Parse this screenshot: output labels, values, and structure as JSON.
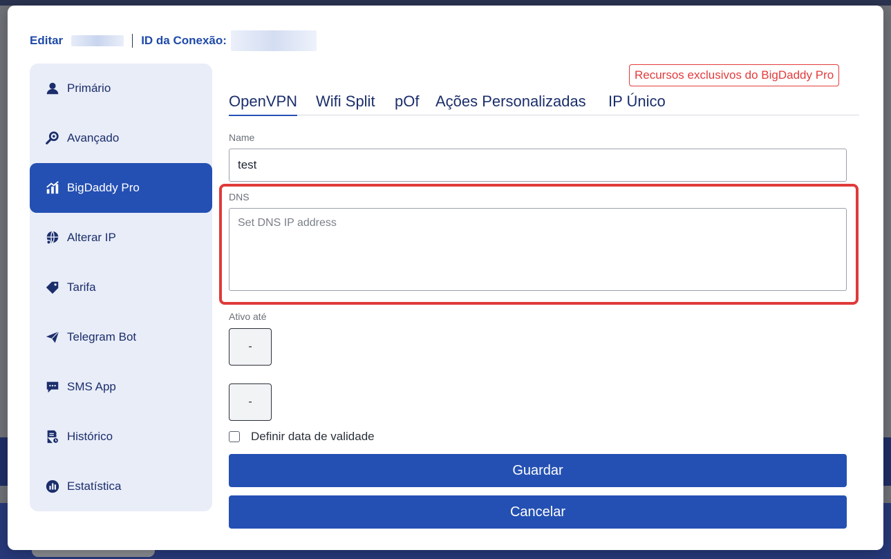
{
  "header": {
    "edit_label": "Editar",
    "connection_id_label": "ID da Conexão:"
  },
  "sidebar": {
    "items": [
      {
        "label": "Primário",
        "icon": "user-icon",
        "active": false
      },
      {
        "label": "Avançado",
        "icon": "gear-search-icon",
        "active": false
      },
      {
        "label": "BigDaddy Pro",
        "icon": "chart-icon",
        "active": true
      },
      {
        "label": "Alterar IP",
        "icon": "globe-icon",
        "active": false
      },
      {
        "label": "Tarifa",
        "icon": "tag-icon",
        "active": false
      },
      {
        "label": "Telegram Bot",
        "icon": "paper-plane-icon",
        "active": false
      },
      {
        "label": "SMS App",
        "icon": "chat-bubble-icon",
        "active": false
      },
      {
        "label": "Histórico",
        "icon": "document-clock-icon",
        "active": false
      },
      {
        "label": "Estatística",
        "icon": "pie-chart-icon",
        "active": false
      }
    ]
  },
  "pro_badge": "Recursos exclusivos do BigDaddy Pro",
  "tabs": [
    {
      "label": "OpenVPN",
      "active": true
    },
    {
      "label": "Wifi Split",
      "active": false
    },
    {
      "label": "pOf",
      "active": false
    },
    {
      "label": "Ações Personalizadas",
      "active": false
    },
    {
      "label": "IP Único",
      "active": false
    }
  ],
  "form": {
    "name_label": "Name",
    "name_value": "test",
    "dns_label": "DNS",
    "dns_placeholder": "Set DNS IP address",
    "active_until_label": "Ativo até",
    "date_start": "-",
    "date_end": "-",
    "validity_checkbox_label": "Definir data de validade"
  },
  "buttons": {
    "save": "Guardar",
    "cancel": "Cancelar"
  },
  "colors": {
    "primary": "#2450b3",
    "accent_red": "#e03a3a",
    "sidebar_bg": "#e9edf8"
  }
}
